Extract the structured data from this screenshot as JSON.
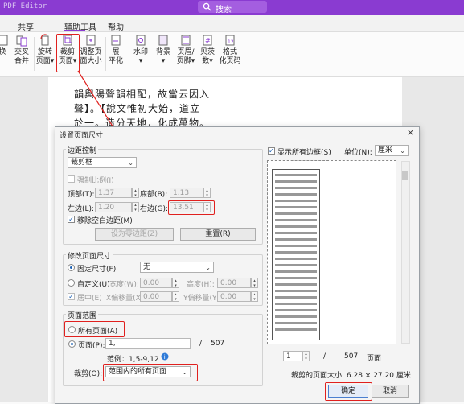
{
  "app": {
    "name": "PDF Editor",
    "search_label": "搜索"
  },
  "menu": {
    "items": [
      "共享",
      "辅助工具",
      "帮助"
    ]
  },
  "toolbar": {
    "buttons": [
      {
        "label1": "换",
        "label2": ""
      },
      {
        "label1": "交叉",
        "label2": "合并"
      },
      {
        "label1": "旋转",
        "label2": "页面▾"
      },
      {
        "label1": "裁剪",
        "label2": "页面▾"
      },
      {
        "label1": "调整页",
        "label2": "面大小"
      },
      {
        "label1": "展",
        "label2": "平化"
      },
      {
        "label1": "水印",
        "label2": "▾"
      },
      {
        "label1": "背景",
        "label2": "▾"
      },
      {
        "label1": "页眉/",
        "label2": "页脚▾"
      },
      {
        "label1": "贝茨",
        "label2": "数▾"
      },
      {
        "label1": "格式",
        "label2": "化页码"
      }
    ]
  },
  "document": {
    "lines": [
      "韻與陽聲韻相配，故當云因入",
      "聲】。【說文惟初大始，道立",
      "於一。造分天地，化成萬物。"
    ]
  },
  "dialog": {
    "title": "设置页面尺寸",
    "close": "×",
    "margins": {
      "group_label": "边距控制",
      "mode": "裁剪框",
      "keep_ratio": "强制比例(I)",
      "top_label": "顶部(T):",
      "top_value": "1.37",
      "bottom_label": "底部(B):",
      "bottom_value": "1.13",
      "left_label": "左边(L):",
      "left_value": "1.20",
      "right_label": "右边(G):",
      "right_value": "13.51",
      "remove_white": "移除空白边距(M)",
      "set_zero": "设为零边距(Z)",
      "reset": "重置(R)"
    },
    "page_size": {
      "group_label": "修改页面尺寸",
      "fixed_label": "固定尺寸(F)",
      "fixed_value": "无",
      "custom_label": "自定义(U)",
      "width_label": "宽度(W):",
      "width_value": "0.00",
      "height_label": "高度(H):",
      "height_value": "0.00",
      "center_label": "居中(E)",
      "xoffset_label": "X偏移量(X):",
      "xoffset_value": "0.00",
      "yoffset_label": "Y偏移量(Y):",
      "yoffset_value": "0.00"
    },
    "page_range": {
      "group_label": "页面范围",
      "all_pages": "所有页面(A)",
      "pages_label": "页面(P):",
      "pages_value": "1,",
      "slash": "/",
      "total": "507",
      "example": "范例：1,5-9,12",
      "crop_label": "裁剪(O):",
      "crop_value": "范围内的所有页面"
    },
    "preview": {
      "show_margins": "显示所有边框(S)",
      "unit_label": "单位(N):",
      "unit_value": "厘米",
      "page_value": "1",
      "slash": "/",
      "total": "507",
      "page_word": "页面",
      "size_text": "裁剪的页面大小: 6.28 × 27.20 厘米"
    },
    "ok": "确定",
    "cancel": "取消"
  },
  "colors": {
    "accent": "#8a3bd1",
    "highlight": "#e0201e"
  }
}
